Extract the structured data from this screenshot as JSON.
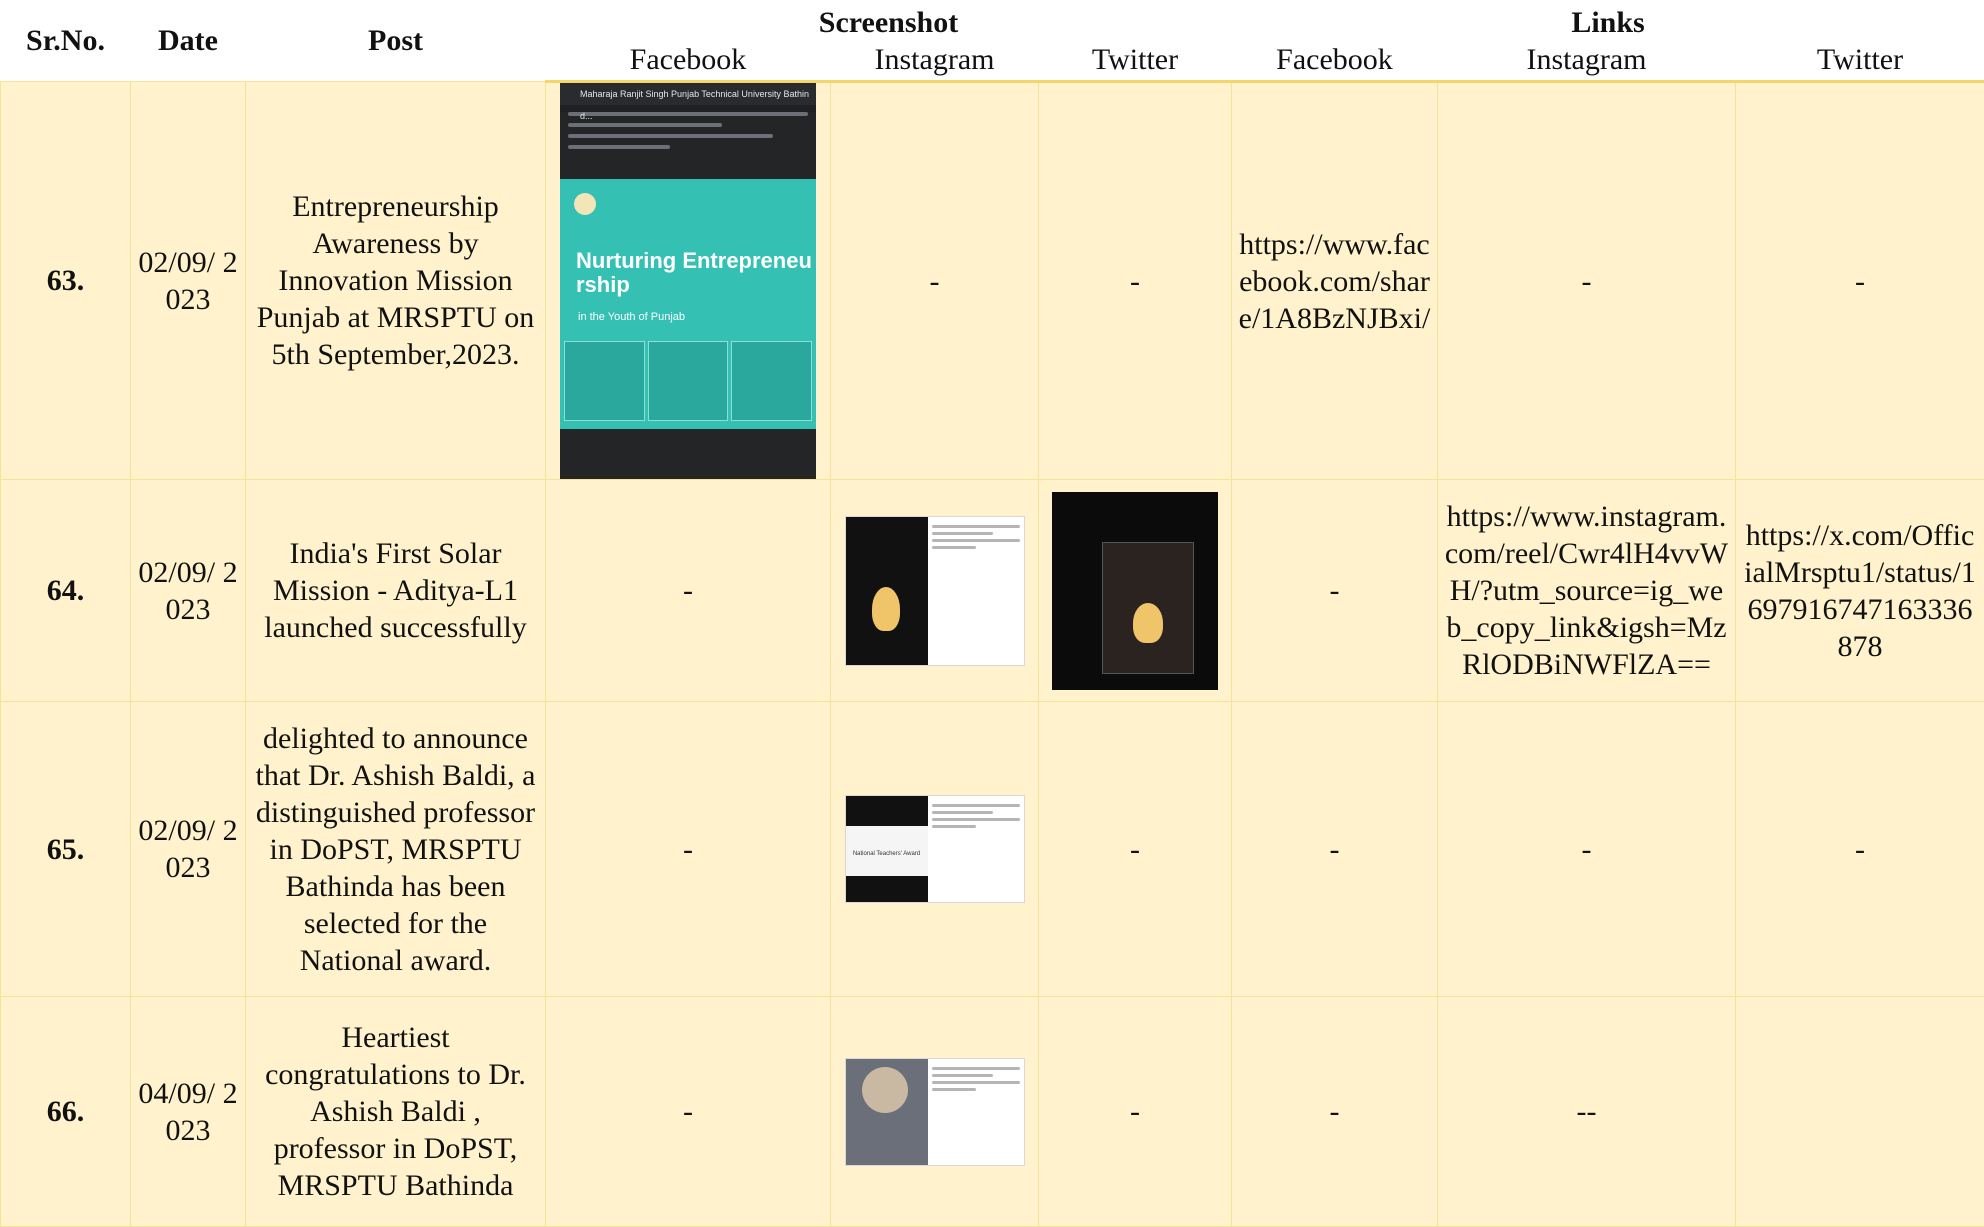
{
  "header": {
    "sr": "Sr.No.",
    "date": "Date",
    "post": "Post",
    "screenshot": "Screenshot",
    "links": "Links",
    "sub": {
      "facebook": "Facebook",
      "instagram": "Instagram",
      "twitter": "Twitter",
      "facebook2": "Facebook",
      "instagram2": "Instagram",
      "twitter2": "Twitter"
    }
  },
  "rows": [
    {
      "sr": "63.",
      "date": "02/09/ 2023",
      "post": "Entrepreneurship Awareness by Innovation Mission Punjab at MRSPTU on 5th September,2023.",
      "ig_shot": "-",
      "tw_shot": "-",
      "fb_link": "https://www.facebook.com/share/1A8BzNJBxi/",
      "ig_link": "-",
      "tw_link": "-",
      "fb_thumb": {
        "title_bar": "Maharaja Ranjit Singh Punjab Technical University Bathind...",
        "poster_title": "Nurturing Entrepreneurship",
        "poster_sub": "in the Youth of Punjab"
      }
    },
    {
      "sr": "64.",
      "date": "02/09/ 2023",
      "post": "India's First Solar Mission - Aditya-L1 launched successfully",
      "fb_shot": "-",
      "fb_link": "-",
      "ig_link": "https://www.instagram.com/reel/Cwr4lH4vvWH/?utm_source=ig_web_copy_link&igsh=MzRlODBiNWFlZA==",
      "tw_link": "https://x.com/OfficialMrsptu1/status/1697916747163336878"
    },
    {
      "sr": "65.",
      "date": "02/09/ 2023",
      "post": "delighted to announce that Dr. Ashish Baldi, a distinguished professor in DoPST, MRSPTU Bathinda has been selected for the National award.",
      "fb_shot": "-",
      "tw_shot": "-",
      "fb_link": "-",
      "ig_link": "-",
      "tw_link": "-",
      "ig_thumb": {
        "caption": "National Teachers' Award"
      }
    },
    {
      "sr": "66.",
      "date": "04/09/ 2023",
      "post": "Heartiest congratulations to Dr. Ashish Baldi , professor in DoPST, MRSPTU Bathinda",
      "fb_shot": "-",
      "tw_shot": "-",
      "fb_link": "-",
      "ig_link": "--"
    }
  ]
}
